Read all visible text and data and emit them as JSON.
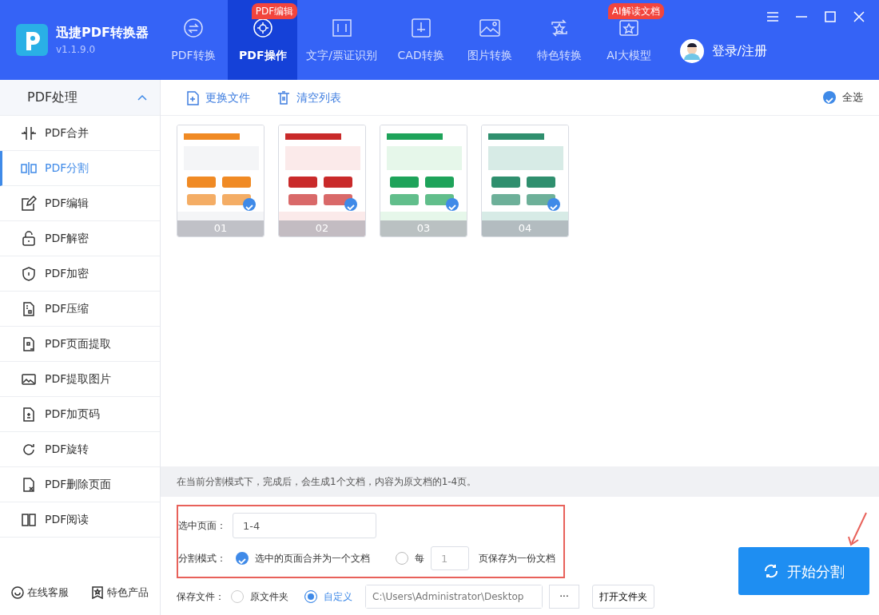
{
  "app": {
    "name": "迅捷PDF转换器",
    "version": "v1.1.9.0"
  },
  "nav_tabs": [
    {
      "label": "PDF转换",
      "selected": false
    },
    {
      "label": "PDF操作",
      "selected": true,
      "badge": "PDF编辑"
    },
    {
      "label": "文字/票证识别",
      "selected": false
    },
    {
      "label": "CAD转换",
      "selected": false
    },
    {
      "label": "图片转换",
      "selected": false
    },
    {
      "label": "特色转换",
      "selected": false
    },
    {
      "label": "AI大模型",
      "selected": false,
      "badge": "AI解读文档"
    }
  ],
  "user": {
    "label": "登录/注册"
  },
  "sidebar": {
    "header": "PDF处理",
    "expanded": true,
    "items": [
      {
        "label": "PDF合并",
        "selected": false
      },
      {
        "label": "PDF分割",
        "selected": true
      },
      {
        "label": "PDF编辑",
        "selected": false
      },
      {
        "label": "PDF解密",
        "selected": false
      },
      {
        "label": "PDF加密",
        "selected": false
      },
      {
        "label": "PDF压缩",
        "selected": false
      },
      {
        "label": "PDF页面提取",
        "selected": false
      },
      {
        "label": "PDF提取图片",
        "selected": false
      },
      {
        "label": "PDF加页码",
        "selected": false
      },
      {
        "label": "PDF旋转",
        "selected": false
      },
      {
        "label": "PDF删除页面",
        "selected": false
      },
      {
        "label": "PDF阅读",
        "selected": false
      }
    ],
    "footer": [
      "在线客服",
      "特色产品"
    ]
  },
  "toolbar": {
    "actions": [
      "更换文件",
      "清空列表"
    ],
    "select_all": {
      "label": "全选",
      "checked": true
    }
  },
  "pages": [
    {
      "label": "01",
      "checked": true
    },
    {
      "label": "02",
      "checked": true
    },
    {
      "label": "03",
      "checked": true
    },
    {
      "label": "04",
      "checked": true
    }
  ],
  "info": "在当前分割模式下，完成后，会生成1个文档，内容为原文档的1-4页。",
  "form": {
    "selected_pages": {
      "label": "选中页面：",
      "value": "1-4"
    },
    "split_mode": {
      "label": "分割模式：",
      "options": [
        {
          "kind": "merge",
          "label": "选中的页面合并为一个文档",
          "selected": true
        },
        {
          "kind": "every",
          "label": "每",
          "value": "1",
          "suffix": "页保存为一份文档",
          "selected": false
        }
      ]
    },
    "save": {
      "label": "保存文件：",
      "options": [
        {
          "label": "原文件夹",
          "selected": false
        },
        {
          "label": "自定义",
          "selected": true
        }
      ],
      "path": "C:\\Users\\Administrator\\Desktop",
      "browse": "···",
      "open": "打开文件夹"
    }
  },
  "start_button": "开始分割"
}
